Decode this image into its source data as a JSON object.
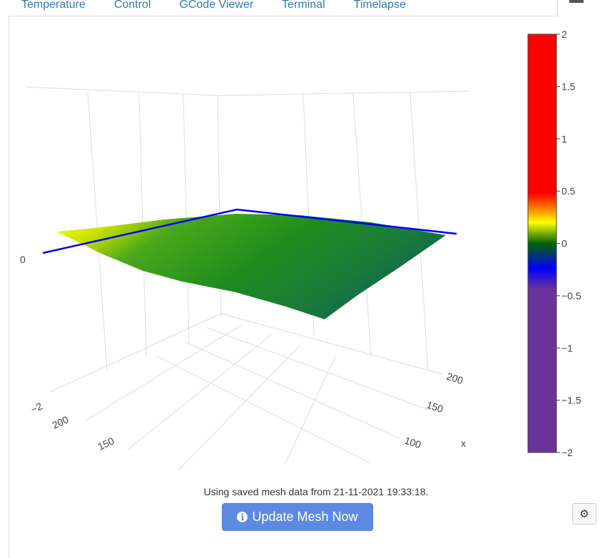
{
  "tabs": [
    "Temperature",
    "Control",
    "GCode Viewer",
    "Terminal",
    "Timelapse"
  ],
  "status_text": "Using saved mesh data from 21-11-2021 19:33:18.",
  "update_button": "Update Mesh Now",
  "icons": {
    "info": "info-circle-icon",
    "settings": "gear-icon",
    "menu": "hamburger-menu-icon"
  },
  "chart_data": {
    "type": "surface",
    "colorbar": {
      "range": [
        -2,
        2
      ],
      "ticks": [
        "2",
        "1.5",
        "1",
        "0.5",
        "0",
        "−0.5",
        "−1",
        "−1.5",
        "−2"
      ],
      "tick_values": [
        2,
        1.5,
        1,
        0.5,
        0,
        -0.5,
        -1,
        -1.5,
        -2
      ],
      "colors": [
        "#6a3399",
        "#6a3399",
        "#0000ff",
        "#006400",
        "#ffff00",
        "#ff8c00",
        "#ff0000",
        "#ff0000"
      ]
    },
    "x_axis": {
      "label": "x",
      "ticks": [
        "100",
        "150",
        "200"
      ]
    },
    "y_axis": {
      "ticks": [
        "150",
        "200"
      ]
    },
    "z_axis": {
      "ticks": [
        "−2",
        "0"
      ]
    }
  }
}
